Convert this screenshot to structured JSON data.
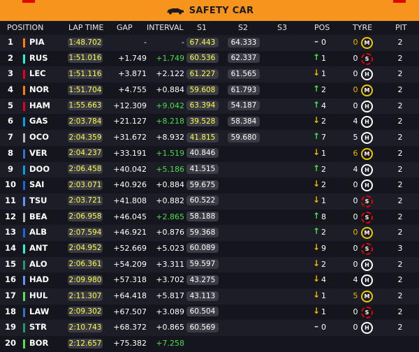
{
  "banner": {
    "title": "SAFETY CAR",
    "icon": "safety-car-icon",
    "color": "#f7941d"
  },
  "header": {
    "position": "POSITION",
    "lap_time": "LAP TIME",
    "gap": "GAP",
    "interval": "INTERVAL",
    "s1": "S1",
    "s2": "S2",
    "s3": "S3",
    "pos": "POS",
    "tyre": "TYRE",
    "pit": "PIT"
  },
  "rows": [
    {
      "pos": "1",
      "code": "PIA",
      "team_color": "#ff8000",
      "lap": "1:48.702",
      "gap": "-",
      "interval": "-",
      "interval_color": "white",
      "s1": "67.443",
      "s1_yellow": true,
      "s2": "64.333",
      "arrow": "–",
      "arrow_type": "dash",
      "delta": "0",
      "stint": "0",
      "stint_yellow": true,
      "tyre": "M",
      "pit": "2"
    },
    {
      "pos": "2",
      "code": "RUS",
      "team_color": "#27f4d2",
      "lap": "1:51.016",
      "gap": "+1.749",
      "interval": "+1.749",
      "interval_color": "green",
      "s1": "60.536",
      "s1_yellow": true,
      "s2": "62.337",
      "arrow": "↑",
      "arrow_type": "up",
      "delta": "1",
      "stint": "0",
      "stint_yellow": false,
      "tyre": "S",
      "pit": "2"
    },
    {
      "pos": "3",
      "code": "LEC",
      "team_color": "#e8002d",
      "lap": "1:51.116",
      "gap": "+3.871",
      "interval": "+2.122",
      "interval_color": "white",
      "s1": "61.227",
      "s1_yellow": true,
      "s2": "61.565",
      "arrow": "↓",
      "arrow_type": "down",
      "delta": "1",
      "stint": "0",
      "stint_yellow": false,
      "tyre": "H",
      "pit": "2"
    },
    {
      "pos": "4",
      "code": "NOR",
      "team_color": "#ff8000",
      "lap": "1:51.704",
      "gap": "+4.755",
      "interval": "+0.884",
      "interval_color": "white",
      "s1": "59.608",
      "s1_yellow": true,
      "s2": "61.793",
      "arrow": "↑",
      "arrow_type": "up",
      "delta": "2",
      "stint": "0",
      "stint_yellow": true,
      "tyre": "M",
      "pit": "2"
    },
    {
      "pos": "5",
      "code": "HAM",
      "team_color": "#e8002d",
      "lap": "1:55.663",
      "gap": "+12.309",
      "interval": "+9.042",
      "interval_color": "green",
      "s1": "63.394",
      "s1_yellow": true,
      "s2": "54.187",
      "arrow": "↑",
      "arrow_type": "up",
      "delta": "4",
      "stint": "0",
      "stint_yellow": false,
      "tyre": "H",
      "pit": "2"
    },
    {
      "pos": "6",
      "code": "GAS",
      "team_color": "#00a1e8",
      "lap": "2:03.784",
      "gap": "+21.127",
      "interval": "+8.218",
      "interval_color": "green",
      "s1": "39.528",
      "s1_yellow": true,
      "s2": "58.384",
      "arrow": "↓",
      "arrow_type": "down",
      "delta": "2",
      "stint": "4",
      "stint_yellow": false,
      "tyre": "H",
      "pit": "2"
    },
    {
      "pos": "7",
      "code": "OCO",
      "team_color": "#b6babd",
      "lap": "2:04.359",
      "gap": "+31.672",
      "interval": "+8.932",
      "interval_color": "white",
      "s1": "41.815",
      "s1_yellow": true,
      "s2": "59.680",
      "arrow": "↑",
      "arrow_type": "up",
      "delta": "7",
      "stint": "5",
      "stint_yellow": false,
      "tyre": "H",
      "pit": "2"
    },
    {
      "pos": "8",
      "code": "VER",
      "team_color": "#3671c6",
      "lap": "2:04.237",
      "gap": "+33.191",
      "interval": "+1.519",
      "interval_color": "green",
      "s1": "40.846",
      "s1_yellow": false,
      "s2": "",
      "arrow": "↓",
      "arrow_type": "down",
      "delta": "1",
      "stint": "6",
      "stint_yellow": true,
      "tyre": "M",
      "pit": "2"
    },
    {
      "pos": "9",
      "code": "DOO",
      "team_color": "#00a1e8",
      "lap": "2:06.458",
      "gap": "+40.042",
      "interval": "+5.186",
      "interval_color": "green",
      "s1": "41.515",
      "s1_yellow": false,
      "s2": "",
      "arrow": "↑",
      "arrow_type": "up",
      "delta": "2",
      "stint": "4",
      "stint_yellow": false,
      "tyre": "H",
      "pit": "2"
    },
    {
      "pos": "10",
      "code": "SAI",
      "team_color": "#1868db",
      "lap": "2:03.071",
      "gap": "+40.926",
      "interval": "+0.884",
      "interval_color": "white",
      "s1": "59.675",
      "s1_yellow": false,
      "s2": "",
      "arrow": "↓",
      "arrow_type": "down",
      "delta": "2",
      "stint": "0",
      "stint_yellow": false,
      "tyre": "H",
      "pit": "2"
    },
    {
      "pos": "11",
      "code": "TSU",
      "team_color": "#6692ff",
      "lap": "2:03.721",
      "gap": "+41.808",
      "interval": "+0.882",
      "interval_color": "white",
      "s1": "60.522",
      "s1_yellow": false,
      "s2": "",
      "arrow": "↓",
      "arrow_type": "down",
      "delta": "1",
      "stint": "0",
      "stint_yellow": false,
      "tyre": "S",
      "pit": "2"
    },
    {
      "pos": "12",
      "code": "BEA",
      "team_color": "#b6babd",
      "lap": "2:06.958",
      "gap": "+46.045",
      "interval": "+2.865",
      "interval_color": "green",
      "s1": "58.188",
      "s1_yellow": false,
      "s2": "",
      "arrow": "↑",
      "arrow_type": "up",
      "delta": "8",
      "stint": "0",
      "stint_yellow": false,
      "tyre": "S",
      "pit": "2"
    },
    {
      "pos": "13",
      "code": "ALB",
      "team_color": "#1868db",
      "lap": "2:07.594",
      "gap": "+46.921",
      "interval": "+0.876",
      "interval_color": "white",
      "s1": "59.368",
      "s1_yellow": false,
      "s2": "",
      "arrow": "↑",
      "arrow_type": "up",
      "delta": "2",
      "stint": "0",
      "stint_yellow": true,
      "tyre": "M",
      "pit": "2"
    },
    {
      "pos": "14",
      "code": "ANT",
      "team_color": "#27f4d2",
      "lap": "2:04.952",
      "gap": "+52.669",
      "interval": "+5.023",
      "interval_color": "white",
      "s1": "60.089",
      "s1_yellow": false,
      "s2": "",
      "arrow": "↓",
      "arrow_type": "down",
      "delta": "9",
      "stint": "0",
      "stint_yellow": false,
      "tyre": "S",
      "pit": "3"
    },
    {
      "pos": "15",
      "code": "ALO",
      "team_color": "#229971",
      "lap": "2:06.361",
      "gap": "+54.209",
      "interval": "+3.311",
      "interval_color": "white",
      "s1": "59.597",
      "s1_yellow": false,
      "s2": "",
      "arrow": "↓",
      "arrow_type": "down",
      "delta": "2",
      "stint": "0",
      "stint_yellow": false,
      "tyre": "H",
      "pit": "2"
    },
    {
      "pos": "16",
      "code": "HAD",
      "team_color": "#6692ff",
      "lap": "2:09.980",
      "gap": "+57.318",
      "interval": "+3.702",
      "interval_color": "white",
      "s1": "43.275",
      "s1_yellow": false,
      "s2": "",
      "arrow": "↓",
      "arrow_type": "down",
      "delta": "4",
      "stint": "4",
      "stint_yellow": false,
      "tyre": "H",
      "pit": "2"
    },
    {
      "pos": "17",
      "code": "HUL",
      "team_color": "#52e252",
      "lap": "2:11.307",
      "gap": "+64.418",
      "interval": "+5.817",
      "interval_color": "white",
      "s1": "43.113",
      "s1_yellow": false,
      "s2": "",
      "arrow": "↓",
      "arrow_type": "down",
      "delta": "1",
      "stint": "5",
      "stint_yellow": true,
      "tyre": "M",
      "pit": "2"
    },
    {
      "pos": "18",
      "code": "LAW",
      "team_color": "#3671c6",
      "lap": "2:09.302",
      "gap": "+67.507",
      "interval": "+3.089",
      "interval_color": "white",
      "s1": "60.504",
      "s1_yellow": false,
      "s2": "",
      "arrow": "↓",
      "arrow_type": "down",
      "delta": "1",
      "stint": "0",
      "stint_yellow": false,
      "tyre": "S",
      "pit": "2"
    },
    {
      "pos": "19",
      "code": "STR",
      "team_color": "#229971",
      "lap": "2:10.743",
      "gap": "+68.372",
      "interval": "+0.865",
      "interval_color": "white",
      "s1": "60.569",
      "s1_yellow": false,
      "s2": "",
      "arrow": "–",
      "arrow_type": "dash",
      "delta": "0",
      "stint": "0",
      "stint_yellow": false,
      "tyre": "H",
      "pit": "2"
    },
    {
      "pos": "20",
      "code": "BOR",
      "team_color": "#52e252",
      "lap": "2:12.657",
      "gap": "+75.382",
      "interval": "+7.258",
      "interval_color": "green",
      "s1": "",
      "s1_yellow": false,
      "s2": "",
      "arrow": "",
      "arrow_type": "dash",
      "delta": "",
      "stint": "",
      "stint_yellow": false,
      "tyre": "",
      "pit": ""
    }
  ]
}
